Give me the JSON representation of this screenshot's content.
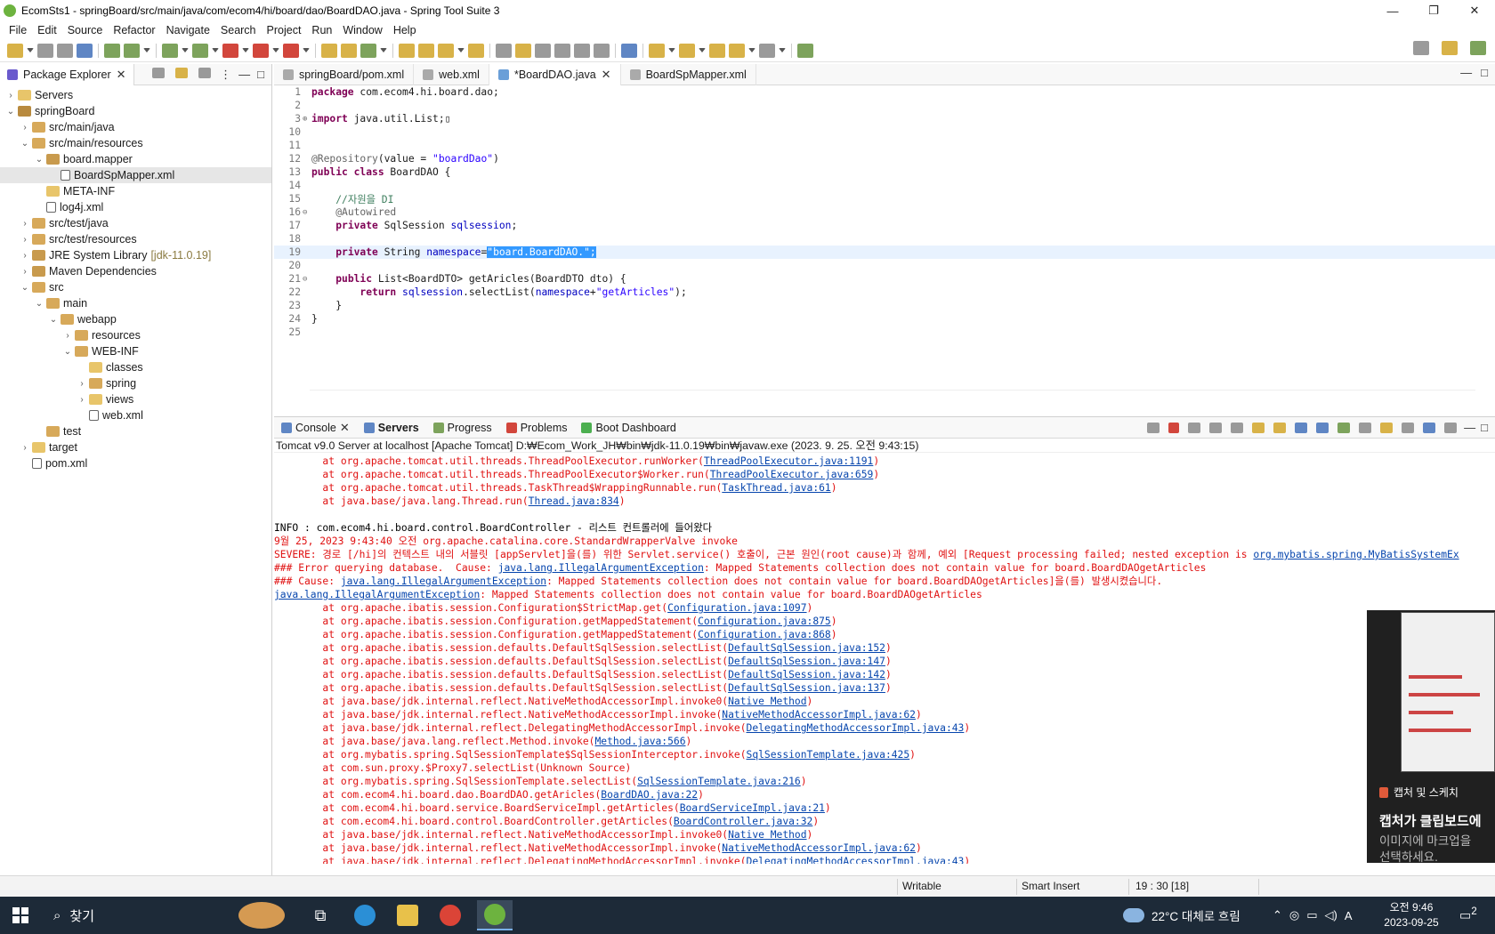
{
  "window": {
    "title": "EcomSts1 - springBoard/src/main/java/com/ecom4/hi/board/dao/BoardDAO.java - Spring Tool Suite 3",
    "buttons": {
      "minimize": "—",
      "maximize": "❐",
      "close": "✕"
    }
  },
  "menu": [
    "File",
    "Edit",
    "Source",
    "Refactor",
    "Navigate",
    "Search",
    "Project",
    "Run",
    "Window",
    "Help"
  ],
  "package_explorer": {
    "tab": "Package Explorer",
    "tree": [
      {
        "label": "Servers",
        "depth": 0,
        "arrow": "›",
        "icon": "folder"
      },
      {
        "label": "springBoard",
        "depth": 0,
        "arrow": "⌄",
        "icon": "proj"
      },
      {
        "label": "src/main/java",
        "depth": 1,
        "arrow": "›",
        "icon": "pkg"
      },
      {
        "label": "src/main/resources",
        "depth": 1,
        "arrow": "⌄",
        "icon": "pkg"
      },
      {
        "label": "board.mapper",
        "depth": 2,
        "arrow": "⌄",
        "icon": "lib"
      },
      {
        "label": "BoardSpMapper.xml",
        "depth": 3,
        "arrow": "",
        "icon": "xml",
        "selected": true
      },
      {
        "label": "META-INF",
        "depth": 2,
        "arrow": "",
        "icon": "folder"
      },
      {
        "label": "log4j.xml",
        "depth": 2,
        "arrow": "",
        "icon": "xml"
      },
      {
        "label": "src/test/java",
        "depth": 1,
        "arrow": "›",
        "icon": "pkg"
      },
      {
        "label": "src/test/resources",
        "depth": 1,
        "arrow": "›",
        "icon": "pkg"
      },
      {
        "label": "JRE System Library",
        "depth": 1,
        "arrow": "›",
        "icon": "lib",
        "extra": "[jdk-11.0.19]"
      },
      {
        "label": "Maven Dependencies",
        "depth": 1,
        "arrow": "›",
        "icon": "lib"
      },
      {
        "label": "src",
        "depth": 1,
        "arrow": "⌄",
        "icon": "pkg"
      },
      {
        "label": "main",
        "depth": 2,
        "arrow": "⌄",
        "icon": "pkg"
      },
      {
        "label": "webapp",
        "depth": 3,
        "arrow": "⌄",
        "icon": "pkg"
      },
      {
        "label": "resources",
        "depth": 4,
        "arrow": "›",
        "icon": "pkg"
      },
      {
        "label": "WEB-INF",
        "depth": 4,
        "arrow": "⌄",
        "icon": "pkg"
      },
      {
        "label": "classes",
        "depth": 5,
        "arrow": "",
        "icon": "folder"
      },
      {
        "label": "spring",
        "depth": 5,
        "arrow": "›",
        "icon": "pkg"
      },
      {
        "label": "views",
        "depth": 5,
        "arrow": "›",
        "icon": "folder"
      },
      {
        "label": "web.xml",
        "depth": 5,
        "arrow": "",
        "icon": "xml"
      },
      {
        "label": "test",
        "depth": 2,
        "arrow": "",
        "icon": "pkg"
      },
      {
        "label": "target",
        "depth": 1,
        "arrow": "›",
        "icon": "folder"
      },
      {
        "label": "pom.xml",
        "depth": 1,
        "arrow": "",
        "icon": "xml"
      }
    ]
  },
  "editor": {
    "tabs": [
      {
        "label": "springBoard/pom.xml",
        "active": false
      },
      {
        "label": "web.xml",
        "active": false
      },
      {
        "label": "*BoardDAO.java",
        "active": true
      },
      {
        "label": "BoardSpMapper.xml",
        "active": false
      }
    ],
    "lines": [
      {
        "n": "1",
        "html": "<span class=\"kw\">package</span> com.ecom4.hi.board.dao;"
      },
      {
        "n": "2",
        "html": ""
      },
      {
        "n": "3",
        "fold": "⊕",
        "html": "<span class=\"kw\">import</span> java.util.List;▯"
      },
      {
        "n": "10",
        "html": ""
      },
      {
        "n": "11",
        "html": ""
      },
      {
        "n": "12",
        "html": "<span class=\"an\">@Repository</span>(value = <span class=\"str\">\"boardDao\"</span>)"
      },
      {
        "n": "13",
        "html": "<span class=\"kw\">public class</span> BoardDAO {"
      },
      {
        "n": "14",
        "html": ""
      },
      {
        "n": "15",
        "html": "    <span class=\"cm\">//자원을 DI</span>"
      },
      {
        "n": "16",
        "fold": "⊖",
        "html": "    <span class=\"an\">@Autowired</span>"
      },
      {
        "n": "17",
        "html": "    <span class=\"kw\">private</span> SqlSession <span class=\"fld\">sqlsession</span>;"
      },
      {
        "n": "18",
        "html": ""
      },
      {
        "n": "19",
        "cur": true,
        "html": "    <span class=\"kw\">private</span> String <span class=\"fld\">namespace</span>=<span class=\"selstr\">\"board.BoardDAO.\";</span>"
      },
      {
        "n": "20",
        "html": ""
      },
      {
        "n": "21",
        "fold": "⊖",
        "html": "    <span class=\"kw\">public</span> List&lt;BoardDTO&gt; getAricles(BoardDTO dto) {"
      },
      {
        "n": "22",
        "html": "        <span class=\"kw\">return</span> <span class=\"fld\">sqlsession</span>.selectList(<span class=\"fld\">namespace</span>+<span class=\"str\">\"getArticles\"</span>);"
      },
      {
        "n": "23",
        "html": "    }"
      },
      {
        "n": "24",
        "html": "}"
      },
      {
        "n": "25",
        "html": ""
      }
    ]
  },
  "console": {
    "tabs": [
      {
        "label": "Console",
        "bold": false,
        "closable": true,
        "color": "#5f86c4"
      },
      {
        "label": "Servers",
        "bold": true,
        "closable": false,
        "color": "#5f86c4"
      },
      {
        "label": "Progress",
        "bold": false,
        "closable": false,
        "color": "#7da35c"
      },
      {
        "label": "Problems",
        "bold": false,
        "closable": false,
        "color": "#d2463c"
      },
      {
        "label": "Boot Dashboard",
        "bold": false,
        "closable": false,
        "color": "#4caf50"
      }
    ],
    "description": "Tomcat v9.0 Server at localhost [Apache Tomcat] D:₩Ecom_Work_JH₩bin₩jdk-11.0.19₩bin₩javaw.exe  (2023. 9. 25. 오전 9:43:15)",
    "lines": [
      {
        "t": "err",
        "html": "        at org.apache.tomcat.util.threads.ThreadPoolExecutor.runWorker(<span class=\"lnk\">ThreadPoolExecutor.java:1191</span>)"
      },
      {
        "t": "err",
        "html": "        at org.apache.tomcat.util.threads.ThreadPoolExecutor$Worker.run(<span class=\"lnk\">ThreadPoolExecutor.java:659</span>)"
      },
      {
        "t": "err",
        "html": "        at org.apache.tomcat.util.threads.TaskThread$WrappingRunnable.run(<span class=\"lnk\">TaskThread.java:61</span>)"
      },
      {
        "t": "err",
        "html": "        at java.base/java.lang.Thread.run(<span class=\"lnk\">Thread.java:834</span>)"
      },
      {
        "t": "info",
        "html": ""
      },
      {
        "t": "info",
        "html": "INFO : com.ecom4.hi.board.control.BoardController - 리스트 컨트롤러에 들어왔다"
      },
      {
        "t": "err",
        "html": "9월 25, 2023 9:43:40 오전 org.apache.catalina.core.StandardWrapperValve invoke"
      },
      {
        "t": "err",
        "html": "SEVERE: 경로 [/hi]의 컨텍스트 내의 서블릿 [appServlet]을(를) 위한 Servlet.service() 호출이, 근본 원인(root cause)과 함께, 예외 [Request processing failed; nested exception is <span class=\"lnk\">org.mybatis.spring.MyBatisSystemEx</span>"
      },
      {
        "t": "err",
        "html": "### Error querying database.  Cause: <span class=\"lnk\">java.lang.IllegalArgumentException</span>: Mapped Statements collection does not contain value for board.BoardDAOgetArticles"
      },
      {
        "t": "err",
        "html": "### Cause: <span class=\"lnk\">java.lang.IllegalArgumentException</span>: Mapped Statements collection does not contain value for board.BoardDAOgetArticles]을(를) 발생시켰습니다."
      },
      {
        "t": "err",
        "html": "<span class=\"lnk\">java.lang.IllegalArgumentException</span>: Mapped Statements collection does not contain value for board.BoardDAOgetArticles"
      },
      {
        "t": "err",
        "html": "        at org.apache.ibatis.session.Configuration$StrictMap.get(<span class=\"lnk\">Configuration.java:1097</span>)"
      },
      {
        "t": "err",
        "html": "        at org.apache.ibatis.session.Configuration.getMappedStatement(<span class=\"lnk\">Configuration.java:875</span>)"
      },
      {
        "t": "err",
        "html": "        at org.apache.ibatis.session.Configuration.getMappedStatement(<span class=\"lnk\">Configuration.java:868</span>)"
      },
      {
        "t": "err",
        "html": "        at org.apache.ibatis.session.defaults.DefaultSqlSession.selectList(<span class=\"lnk\">DefaultSqlSession.java:152</span>)"
      },
      {
        "t": "err",
        "html": "        at org.apache.ibatis.session.defaults.DefaultSqlSession.selectList(<span class=\"lnk\">DefaultSqlSession.java:147</span>)"
      },
      {
        "t": "err",
        "html": "        at org.apache.ibatis.session.defaults.DefaultSqlSession.selectList(<span class=\"lnk\">DefaultSqlSession.java:142</span>)"
      },
      {
        "t": "err",
        "html": "        at org.apache.ibatis.session.defaults.DefaultSqlSession.selectList(<span class=\"lnk\">DefaultSqlSession.java:137</span>)"
      },
      {
        "t": "err",
        "html": "        at java.base/jdk.internal.reflect.NativeMethodAccessorImpl.invoke0(<span class=\"lnk\">Native Method</span>)"
      },
      {
        "t": "err",
        "html": "        at java.base/jdk.internal.reflect.NativeMethodAccessorImpl.invoke(<span class=\"lnk\">NativeMethodAccessorImpl.java:62</span>)"
      },
      {
        "t": "err",
        "html": "        at java.base/jdk.internal.reflect.DelegatingMethodAccessorImpl.invoke(<span class=\"lnk\">DelegatingMethodAccessorImpl.java:43</span>)"
      },
      {
        "t": "err",
        "html": "        at java.base/java.lang.reflect.Method.invoke(<span class=\"lnk\">Method.java:566</span>)"
      },
      {
        "t": "err",
        "html": "        at org.mybatis.spring.SqlSessionTemplate$SqlSessionInterceptor.invoke(<span class=\"lnk\">SqlSessionTemplate.java:425</span>)"
      },
      {
        "t": "err",
        "html": "        at com.sun.proxy.$Proxy7.selectList(Unknown Source)"
      },
      {
        "t": "err",
        "html": "        at org.mybatis.spring.SqlSessionTemplate.selectList(<span class=\"lnk\">SqlSessionTemplate.java:216</span>)"
      },
      {
        "t": "err",
        "html": "        at com.ecom4.hi.board.dao.BoardDAO.getAricles(<span class=\"lnk\">BoardDAO.java:22</span>)"
      },
      {
        "t": "err",
        "html": "        at com.ecom4.hi.board.service.BoardServiceImpl.getArticles(<span class=\"lnk\">BoardServiceImpl.java:21</span>)"
      },
      {
        "t": "err",
        "html": "        at com.ecom4.hi.board.control.BoardController.getArticles(<span class=\"lnk\">BoardController.java:32</span>)"
      },
      {
        "t": "err",
        "html": "        at java.base/jdk.internal.reflect.NativeMethodAccessorImpl.invoke0(<span class=\"lnk\">Native Method</span>)"
      },
      {
        "t": "err",
        "html": "        at java.base/jdk.internal.reflect.NativeMethodAccessorImpl.invoke(<span class=\"lnk\">NativeMethodAccessorImpl.java:62</span>)"
      },
      {
        "t": "err",
        "html": "        at java.base/jdk.internal.reflect.DelegatingMethodAccessorImpl.invoke(<span class=\"lnk\">DelegatingMethodAccessorImpl.java:43</span>)"
      }
    ]
  },
  "toast": {
    "app": "캡처 및 스케치",
    "heading": "캡처가 클립보드에",
    "body1": "이미지에 마크업을",
    "body2": "선택하세요."
  },
  "status_bar": {
    "mode": "Writable",
    "insert": "Smart Insert",
    "position": "19 : 30 [18]"
  },
  "taskbar": {
    "search_placeholder": "찾기",
    "weather": "22°C  대체로 흐림",
    "ime": "A",
    "time": "오전 9:46",
    "date": "2023-09-25",
    "notifications": "2"
  }
}
